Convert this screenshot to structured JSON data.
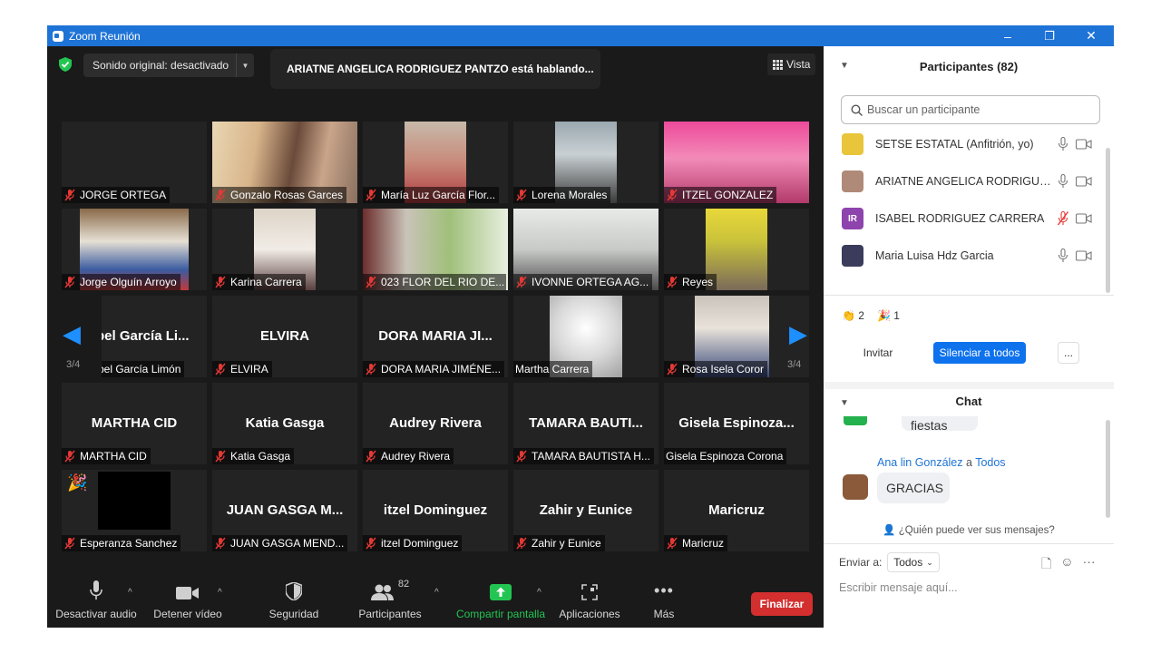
{
  "window": {
    "title": "Zoom Reunión",
    "minimize": "–",
    "restore": "❐",
    "close": "✕"
  },
  "top": {
    "audio_label": "Sonido original: desactivado",
    "speaking_label": "ARIATNE ANGELICA RODRIGUEZ PANTZO está hablando...",
    "view_label": "Vista"
  },
  "pagination": {
    "left_label": "3/4",
    "right_label": "3/4"
  },
  "grid": [
    {
      "name": "JORGE ORTEGA",
      "big": "",
      "muted": true
    },
    {
      "name": "Gonzalo Rosas Garces",
      "big": "",
      "muted": true
    },
    {
      "name": "María Luz García Flor...",
      "big": "",
      "muted": true
    },
    {
      "name": "Lorena Morales",
      "big": "",
      "muted": true
    },
    {
      "name": "ITZEL GONZALEZ",
      "big": "",
      "muted": true
    },
    {
      "name": "Jorge Olguín Arroyo",
      "big": "",
      "muted": true
    },
    {
      "name": "Karina Carrera",
      "big": "",
      "muted": true
    },
    {
      "name": "023 FLOR DEL RIO DE...",
      "big": "",
      "muted": true
    },
    {
      "name": "IVONNE ORTEGA AG...",
      "big": "",
      "muted": true
    },
    {
      "name": "Reyes",
      "big": "",
      "muted": true
    },
    {
      "name": "bel García Limón",
      "big": "bel García Li...",
      "muted": false
    },
    {
      "name": "ELVIRA",
      "big": "ELVIRA",
      "muted": true
    },
    {
      "name": "DORA MARIA JIMÉNE...",
      "big": "DORA MARIA JI...",
      "muted": true
    },
    {
      "name": "Martha Carrera",
      "big": "",
      "muted": false
    },
    {
      "name": "Rosa Isela Coror",
      "big": "",
      "muted": true
    },
    {
      "name": "MARTHA CID",
      "big": "MARTHA CID",
      "muted": true
    },
    {
      "name": "Katia Gasga",
      "big": "Katia Gasga",
      "muted": true
    },
    {
      "name": "Audrey Rivera",
      "big": "Audrey Rivera",
      "muted": true
    },
    {
      "name": "TAMARA BAUTISTA H...",
      "big": "TAMARA BAUTI...",
      "muted": true
    },
    {
      "name": "Gisela Espinoza Corona",
      "big": "Gisela  Espinoza...",
      "muted": false
    },
    {
      "name": "Esperanza Sanchez",
      "big": "",
      "muted": true
    },
    {
      "name": "JUAN GASGA MEND...",
      "big": "JUAN GASGA M...",
      "muted": true
    },
    {
      "name": "itzel Dominguez",
      "big": "itzel Dominguez",
      "muted": true
    },
    {
      "name": "Zahir y Eunice",
      "big": "Zahir y Eunice",
      "muted": true
    },
    {
      "name": "Maricruz",
      "big": "Maricruz",
      "muted": true
    }
  ],
  "toolbar": {
    "mute": "Desactivar audio",
    "video": "Detener vídeo",
    "security": "Seguridad",
    "participants": "Participantes",
    "participants_count": "82",
    "share": "Compartir pantalla",
    "apps": "Aplicaciones",
    "more": "Más",
    "end": "Finalizar"
  },
  "participants_panel": {
    "title": "Participantes (82)",
    "search_placeholder": "Buscar un participante",
    "list": [
      {
        "name": "SETSE ESTATAL (Anfitrión, yo)",
        "avatar": "",
        "avatar_color": "#e8c53a"
      },
      {
        "name": "ARIATNE ANGELICA RODRIGUEZ PANTZO",
        "avatar": "",
        "avatar_color": "#b08a78"
      },
      {
        "name": "ISABEL RODRIGUEZ CARRERA",
        "avatar": "IR",
        "avatar_color": "#8e44ad"
      },
      {
        "name": "Maria Luisa Hdz Garcia",
        "avatar": "",
        "avatar_color": "#3b3b5c"
      }
    ],
    "reactions": [
      {
        "emoji": "👏",
        "count": "2"
      },
      {
        "emoji": "🎉",
        "count": "1"
      }
    ],
    "invite": "Invitar",
    "mute_all": "Silenciar a todos",
    "more": "..."
  },
  "chat": {
    "title": "Chat",
    "prev_message": "felices fiestas",
    "sender": "Ana lin González",
    "to_word": "a",
    "recipient": "Todos",
    "message": "GRACIAS",
    "who_can_see": "¿Quién puede ver sus mensajes?",
    "send_to_label": "Enviar a:",
    "send_to_value": "Todos",
    "input_placeholder": "Escribir mensaje aquí..."
  },
  "colors": {
    "accent": "#1e73d6",
    "share_green": "#23c552",
    "end_red": "#d32f2f",
    "mute_red": "#e53935"
  }
}
